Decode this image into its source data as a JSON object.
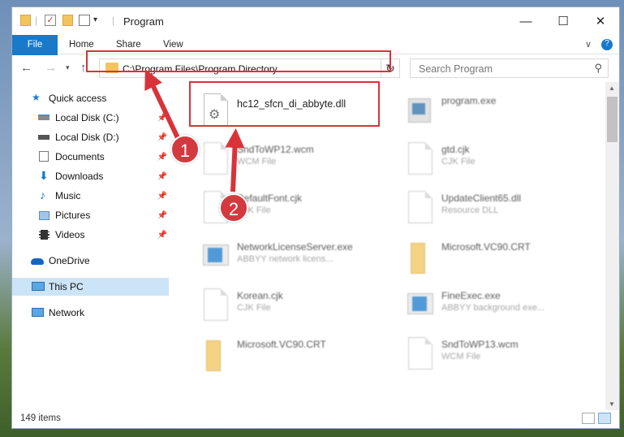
{
  "window": {
    "title": "Program",
    "controls": {
      "minimize": "—",
      "maximize": "☐",
      "close": "✕"
    }
  },
  "ribbon": {
    "tabs": [
      "File",
      "Home",
      "Share",
      "View"
    ],
    "expand_icon": "chevron-down-icon",
    "help_icon": "help-icon"
  },
  "nav": {
    "address": "C:\\Program Files\\Program Directory",
    "search_placeholder": "Search Program"
  },
  "sidebar": {
    "items": [
      {
        "label": "Quick access",
        "icon": "star-icon"
      },
      {
        "label": "Local Disk (C:)",
        "icon": "drive-icon",
        "pinned": true
      },
      {
        "label": "Local Disk (D:)",
        "icon": "drive-icon",
        "pinned": true
      },
      {
        "label": "Documents",
        "icon": "documents-icon",
        "pinned": true
      },
      {
        "label": "Downloads",
        "icon": "downloads-icon",
        "pinned": true
      },
      {
        "label": "Music",
        "icon": "music-icon",
        "pinned": true
      },
      {
        "label": "Pictures",
        "icon": "pictures-icon",
        "pinned": true
      },
      {
        "label": "Videos",
        "icon": "videos-icon",
        "pinned": true
      },
      {
        "label": "OneDrive",
        "icon": "cloud-icon"
      },
      {
        "label": "This PC",
        "icon": "pc-icon",
        "selected": true
      },
      {
        "label": "Network",
        "icon": "network-icon"
      }
    ]
  },
  "files": [
    {
      "name": "hc12_sfcn_di_abbyte.dll",
      "sub": "",
      "icon": "dll-icon"
    },
    {
      "name": "program.exe",
      "sub": "",
      "icon": "exe-icon"
    },
    {
      "name": "SndToWP12.wcm",
      "sub": "WCM File",
      "icon": "file-icon"
    },
    {
      "name": "gtd.cjk",
      "sub": "CJK File",
      "icon": "file-icon"
    },
    {
      "name": "DefaultFont.cjk",
      "sub": "CJK File",
      "icon": "file-icon"
    },
    {
      "name": "UpdateClient65.dll",
      "sub": "Resource DLL",
      "icon": "file-icon"
    },
    {
      "name": "NetworkLicenseServer.exe",
      "sub": "ABBYY network licens...",
      "icon": "app-icon"
    },
    {
      "name": "Microsoft.VC90.CRT",
      "sub": "",
      "icon": "folder-icon"
    },
    {
      "name": "Korean.cjk",
      "sub": "CJK File",
      "icon": "file-icon"
    },
    {
      "name": "FineExec.exe",
      "sub": "ABBYY background exe...",
      "icon": "app-icon"
    },
    {
      "name": "Microsoft.VC90.CRT",
      "sub": "",
      "icon": "folder-icon"
    },
    {
      "name": "SndToWP13.wcm",
      "sub": "WCM File",
      "icon": "file-icon"
    }
  ],
  "status": {
    "count": "149 items"
  },
  "annotations": {
    "step1": "1",
    "step2": "2",
    "color": "#d9333a"
  }
}
